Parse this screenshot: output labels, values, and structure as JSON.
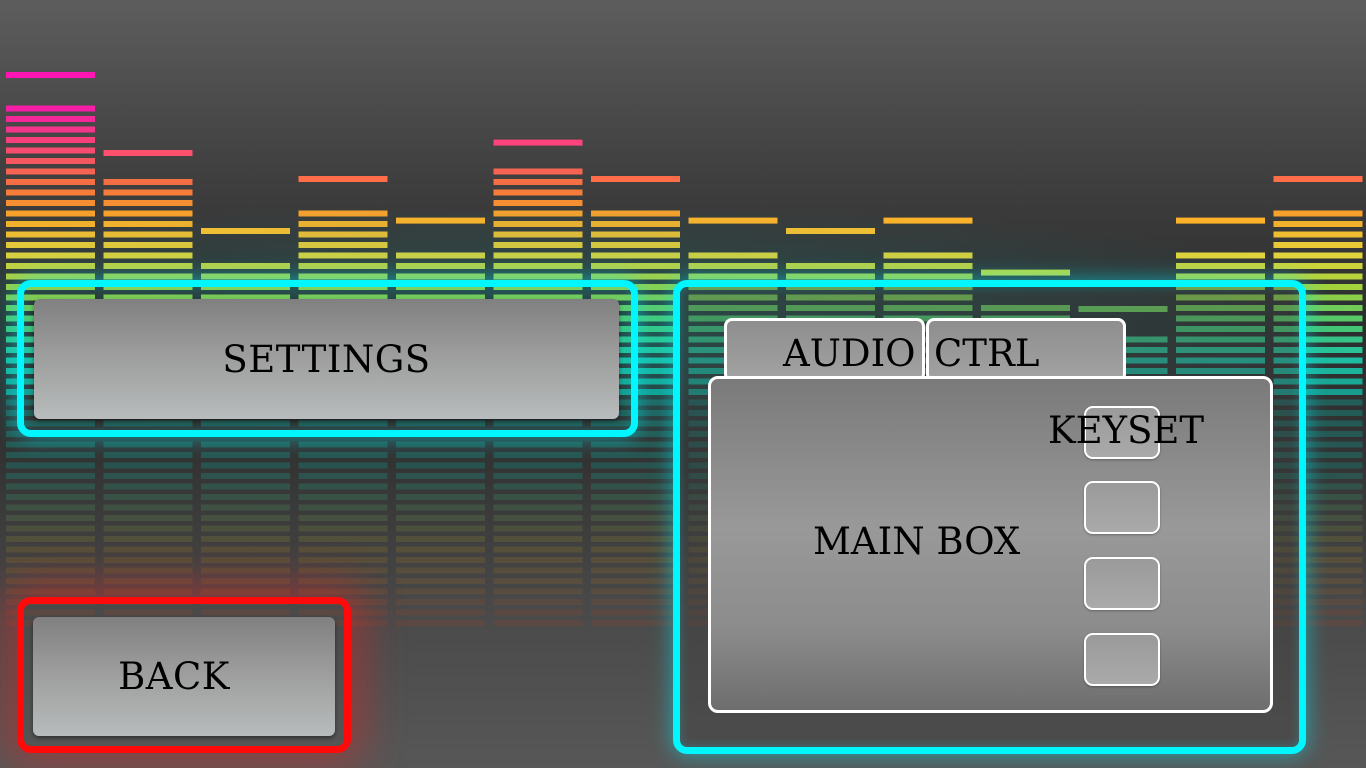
{
  "menu": {
    "settings_label": "SETTINGS",
    "back_label": "BACK"
  },
  "panel": {
    "tab_audio_label": "AUDIO",
    "tab_ctrl_label": "CTRL",
    "main_box_label": "MAIN BOX",
    "keyset_label": "KEYSET"
  },
  "colors": {
    "frame_accent": "#00f7ff",
    "back_frame": "#ff0a0a"
  },
  "background": {
    "equalizer_bar_levels": [
      1.0,
      0.85,
      0.7,
      0.8,
      0.72,
      0.87,
      0.8,
      0.72,
      0.7,
      0.72,
      0.62,
      0.55,
      0.72,
      0.8
    ]
  }
}
